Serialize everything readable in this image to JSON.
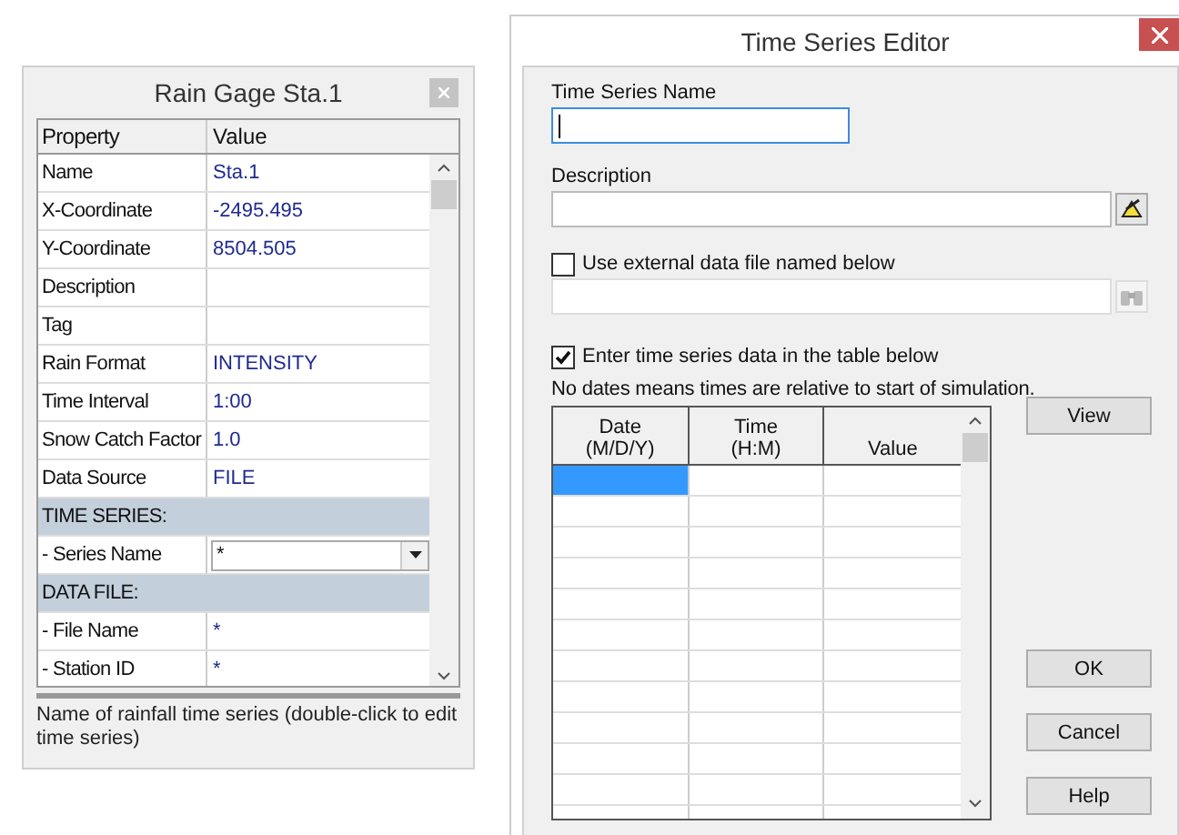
{
  "property_window": {
    "title": "Rain Gage Sta.1",
    "columns": [
      "Property",
      "Value"
    ],
    "rows": [
      {
        "kind": "property",
        "property": "Name",
        "value": "Sta.1"
      },
      {
        "kind": "property",
        "property": "X-Coordinate",
        "value": "-2495.495"
      },
      {
        "kind": "property",
        "property": "Y-Coordinate",
        "value": "8504.505"
      },
      {
        "kind": "property",
        "property": "Description"
      },
      {
        "kind": "property",
        "property": "Tag"
      },
      {
        "kind": "property",
        "property": "Rain Format",
        "value": "INTENSITY"
      },
      {
        "kind": "property",
        "property": "Time Interval",
        "value": "1:00"
      },
      {
        "kind": "property",
        "property": "Snow Catch Factor",
        "value": "1.0"
      },
      {
        "kind": "property",
        "property": "Data Source",
        "value": "FILE"
      },
      {
        "kind": "section",
        "property": "TIME SERIES:"
      },
      {
        "kind": "dropdown",
        "property": " - Series Name",
        "value": "*"
      },
      {
        "kind": "section",
        "property": "DATA FILE:"
      },
      {
        "kind": "property",
        "property": " - File Name",
        "value": "*"
      },
      {
        "kind": "property",
        "property": " - Station ID",
        "value": "*"
      }
    ],
    "status": "Name of rainfall time series (double-click to edit time series)"
  },
  "editor": {
    "title": "Time Series Editor",
    "name_field": {
      "label": "Time Series Name",
      "focused": true
    },
    "description_field": {
      "label": "Description"
    },
    "external_file": {
      "label": "Use external data file named below",
      "checked": false
    },
    "table_entry": {
      "label": "Enter time series data in the table below",
      "checked": true
    },
    "note": "No dates means times are relative to start of simulation.",
    "table": {
      "columns": [
        [
          "Date",
          "(M/D/Y)"
        ],
        [
          "Time",
          "(H:M)"
        ],
        [
          "Value"
        ]
      ],
      "rows": [
        {
          "selected": true
        },
        {
          "selected": false
        },
        {
          "selected": false
        },
        {
          "selected": false
        },
        {
          "selected": false
        },
        {
          "selected": false
        },
        {
          "selected": false
        },
        {
          "selected": false
        },
        {
          "selected": false
        },
        {
          "selected": false
        },
        {
          "selected": false
        },
        {
          "selected": false
        }
      ]
    },
    "buttons": [
      "View",
      "OK",
      "Cancel",
      "Help"
    ]
  }
}
